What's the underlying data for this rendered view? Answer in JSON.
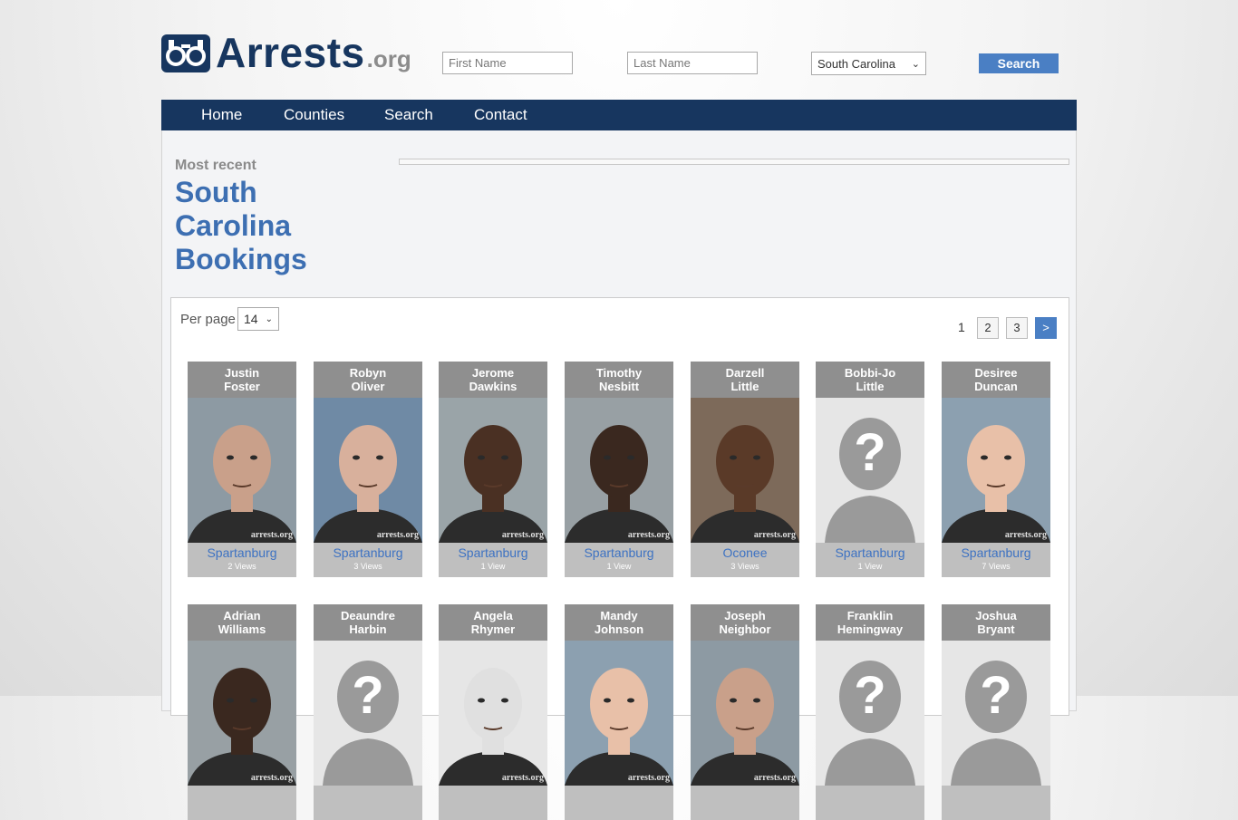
{
  "header": {
    "logo_text": "Arrests",
    "logo_tld": ".org",
    "first_name_placeholder": "First Name",
    "last_name_placeholder": "Last Name",
    "state_selected": "South Carolina",
    "search_label": "Search"
  },
  "nav": {
    "items": [
      "Home",
      "Counties",
      "Search",
      "Contact"
    ]
  },
  "page": {
    "most_recent": "Most recent",
    "title": "South Carolina Bookings"
  },
  "listing": {
    "per_page_label": "Per page",
    "per_page_value": "14",
    "pagination": {
      "current": "1",
      "pages": [
        "2",
        "3"
      ],
      "next": ">"
    },
    "watermark": "arrests.org",
    "row1": [
      {
        "first": "Justin",
        "last": "Foster",
        "county": "Spartanburg",
        "views": "2 Views",
        "photo": "mugshot"
      },
      {
        "first": "Robyn",
        "last": "Oliver",
        "county": "Spartanburg",
        "views": "3 Views",
        "photo": "mugshot"
      },
      {
        "first": "Jerome",
        "last": "Dawkins",
        "county": "Spartanburg",
        "views": "1 View",
        "photo": "mugshot"
      },
      {
        "first": "Timothy",
        "last": "Nesbitt",
        "county": "Spartanburg",
        "views": "1 View",
        "photo": "mugshot"
      },
      {
        "first": "Darzell",
        "last": "Little",
        "county": "Oconee",
        "views": "3 Views",
        "photo": "mugshot"
      },
      {
        "first": "Bobbi-Jo",
        "last": "Little",
        "county": "Spartanburg",
        "views": "1 View",
        "photo": "unknown"
      },
      {
        "first": "Desiree",
        "last": "Duncan",
        "county": "Spartanburg",
        "views": "7 Views",
        "photo": "mugshot"
      }
    ],
    "row2": [
      {
        "first": "Adrian",
        "last": "Williams",
        "photo": "mugshot"
      },
      {
        "first": "Deaundre",
        "last": "Harbin",
        "photo": "unknown"
      },
      {
        "first": "Angela",
        "last": "Rhymer",
        "photo": "mugshot"
      },
      {
        "first": "Mandy",
        "last": "Johnson",
        "photo": "mugshot"
      },
      {
        "first": "Joseph",
        "last": "Neighbor",
        "photo": "mugshot"
      },
      {
        "first": "Franklin",
        "last": "Hemingway",
        "photo": "unknown"
      },
      {
        "first": "Joshua",
        "last": "Bryant",
        "photo": "unknown"
      }
    ]
  },
  "colors": {
    "brand": "#17365f",
    "accent": "#4a7fc4",
    "link": "#3d72c2"
  }
}
